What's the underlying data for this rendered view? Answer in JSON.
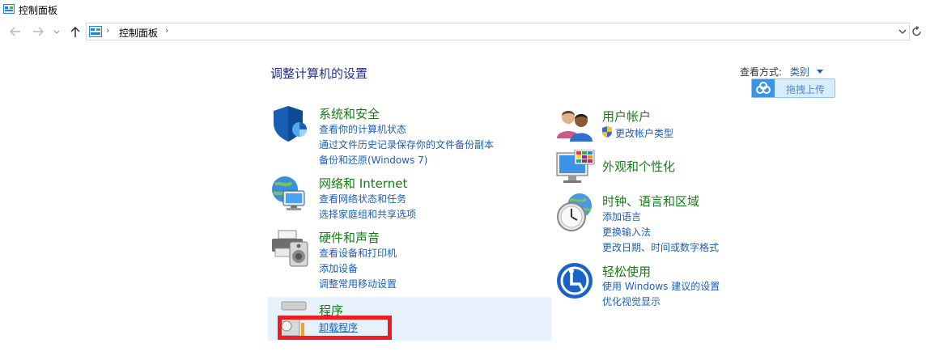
{
  "window": {
    "title": "控制面板",
    "icon": "control-panel-icon"
  },
  "navigation": {
    "back_icon": "back-arrow-icon",
    "forward_icon": "forward-arrow-icon",
    "recent_icon": "chevron-down-icon",
    "up_icon": "up-arrow-icon",
    "breadcrumb": [
      "控制面板"
    ],
    "breadcrumb_separator": "›",
    "dropdown_icon": "chevron-down-icon",
    "refresh_icon": "refresh-icon"
  },
  "main": {
    "heading": "调整计算机的设置",
    "view_by": {
      "label": "查看方式:",
      "value": "类别"
    },
    "upload_button": {
      "label": "拖拽上传",
      "icon": "cloud-icon"
    },
    "categories_left": [
      {
        "title": "系统和安全",
        "icon": "shield-icon",
        "links": [
          "查看你的计算机状态",
          "通过文件历史记录保存你的文件备份副本",
          "备份和还原(Windows 7)"
        ]
      },
      {
        "title": "网络和 Internet",
        "icon": "network-icon",
        "links": [
          "查看网络状态和任务",
          "选择家庭组和共享选项"
        ]
      },
      {
        "title": "硬件和声音",
        "icon": "printer-speaker-icon",
        "links": [
          "查看设备和打印机",
          "添加设备",
          "调整常用移动设置"
        ]
      },
      {
        "title": "程序",
        "icon": "programs-icon",
        "links": [
          "卸载程序"
        ]
      }
    ],
    "categories_right": [
      {
        "title": "用户帐户",
        "icon": "users-icon",
        "links": [
          "更改帐户类型"
        ],
        "link_icon": "uac-shield-icon"
      },
      {
        "title": "外观和个性化",
        "icon": "monitor-palette-icon",
        "links": []
      },
      {
        "title": "时钟、语言和区域",
        "icon": "clock-globe-icon",
        "links": [
          "添加语言",
          "更换输入法",
          "更改日期、时间或数字格式"
        ]
      },
      {
        "title": "轻松使用",
        "icon": "ease-of-access-icon",
        "links": [
          "使用 Windows 建议的设置",
          "优化视觉显示"
        ]
      }
    ]
  },
  "colors": {
    "category_title": "#1a7a1a",
    "link": "#1e5fb4",
    "heading": "#1e3287",
    "highlight_bg": "#e6f1fb",
    "annotation_red": "#ee1c25"
  }
}
